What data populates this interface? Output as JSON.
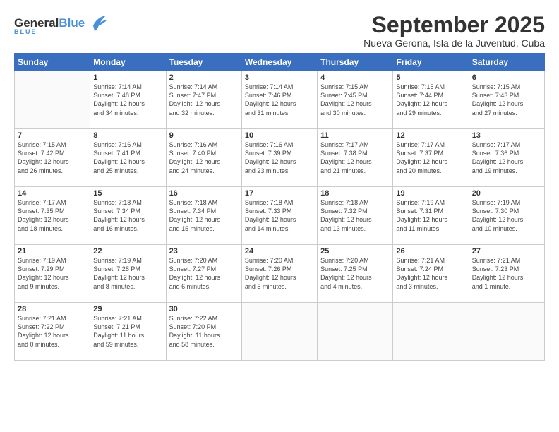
{
  "header": {
    "logo": {
      "general": "General",
      "blue": "Blue",
      "tagline": "BLUE"
    },
    "title": "September 2025",
    "subtitle": "Nueva Gerona, Isla de la Juventud, Cuba"
  },
  "weekdays": [
    "Sunday",
    "Monday",
    "Tuesday",
    "Wednesday",
    "Thursday",
    "Friday",
    "Saturday"
  ],
  "weeks": [
    [
      {
        "num": "",
        "lines": []
      },
      {
        "num": "1",
        "lines": [
          "Sunrise: 7:14 AM",
          "Sunset: 7:48 PM",
          "Daylight: 12 hours",
          "and 34 minutes."
        ]
      },
      {
        "num": "2",
        "lines": [
          "Sunrise: 7:14 AM",
          "Sunset: 7:47 PM",
          "Daylight: 12 hours",
          "and 32 minutes."
        ]
      },
      {
        "num": "3",
        "lines": [
          "Sunrise: 7:14 AM",
          "Sunset: 7:46 PM",
          "Daylight: 12 hours",
          "and 31 minutes."
        ]
      },
      {
        "num": "4",
        "lines": [
          "Sunrise: 7:15 AM",
          "Sunset: 7:45 PM",
          "Daylight: 12 hours",
          "and 30 minutes."
        ]
      },
      {
        "num": "5",
        "lines": [
          "Sunrise: 7:15 AM",
          "Sunset: 7:44 PM",
          "Daylight: 12 hours",
          "and 29 minutes."
        ]
      },
      {
        "num": "6",
        "lines": [
          "Sunrise: 7:15 AM",
          "Sunset: 7:43 PM",
          "Daylight: 12 hours",
          "and 27 minutes."
        ]
      }
    ],
    [
      {
        "num": "7",
        "lines": [
          "Sunrise: 7:15 AM",
          "Sunset: 7:42 PM",
          "Daylight: 12 hours",
          "and 26 minutes."
        ]
      },
      {
        "num": "8",
        "lines": [
          "Sunrise: 7:16 AM",
          "Sunset: 7:41 PM",
          "Daylight: 12 hours",
          "and 25 minutes."
        ]
      },
      {
        "num": "9",
        "lines": [
          "Sunrise: 7:16 AM",
          "Sunset: 7:40 PM",
          "Daylight: 12 hours",
          "and 24 minutes."
        ]
      },
      {
        "num": "10",
        "lines": [
          "Sunrise: 7:16 AM",
          "Sunset: 7:39 PM",
          "Daylight: 12 hours",
          "and 23 minutes."
        ]
      },
      {
        "num": "11",
        "lines": [
          "Sunrise: 7:17 AM",
          "Sunset: 7:38 PM",
          "Daylight: 12 hours",
          "and 21 minutes."
        ]
      },
      {
        "num": "12",
        "lines": [
          "Sunrise: 7:17 AM",
          "Sunset: 7:37 PM",
          "Daylight: 12 hours",
          "and 20 minutes."
        ]
      },
      {
        "num": "13",
        "lines": [
          "Sunrise: 7:17 AM",
          "Sunset: 7:36 PM",
          "Daylight: 12 hours",
          "and 19 minutes."
        ]
      }
    ],
    [
      {
        "num": "14",
        "lines": [
          "Sunrise: 7:17 AM",
          "Sunset: 7:35 PM",
          "Daylight: 12 hours",
          "and 18 minutes."
        ]
      },
      {
        "num": "15",
        "lines": [
          "Sunrise: 7:18 AM",
          "Sunset: 7:34 PM",
          "Daylight: 12 hours",
          "and 16 minutes."
        ]
      },
      {
        "num": "16",
        "lines": [
          "Sunrise: 7:18 AM",
          "Sunset: 7:34 PM",
          "Daylight: 12 hours",
          "and 15 minutes."
        ]
      },
      {
        "num": "17",
        "lines": [
          "Sunrise: 7:18 AM",
          "Sunset: 7:33 PM",
          "Daylight: 12 hours",
          "and 14 minutes."
        ]
      },
      {
        "num": "18",
        "lines": [
          "Sunrise: 7:18 AM",
          "Sunset: 7:32 PM",
          "Daylight: 12 hours",
          "and 13 minutes."
        ]
      },
      {
        "num": "19",
        "lines": [
          "Sunrise: 7:19 AM",
          "Sunset: 7:31 PM",
          "Daylight: 12 hours",
          "and 11 minutes."
        ]
      },
      {
        "num": "20",
        "lines": [
          "Sunrise: 7:19 AM",
          "Sunset: 7:30 PM",
          "Daylight: 12 hours",
          "and 10 minutes."
        ]
      }
    ],
    [
      {
        "num": "21",
        "lines": [
          "Sunrise: 7:19 AM",
          "Sunset: 7:29 PM",
          "Daylight: 12 hours",
          "and 9 minutes."
        ]
      },
      {
        "num": "22",
        "lines": [
          "Sunrise: 7:19 AM",
          "Sunset: 7:28 PM",
          "Daylight: 12 hours",
          "and 8 minutes."
        ]
      },
      {
        "num": "23",
        "lines": [
          "Sunrise: 7:20 AM",
          "Sunset: 7:27 PM",
          "Daylight: 12 hours",
          "and 6 minutes."
        ]
      },
      {
        "num": "24",
        "lines": [
          "Sunrise: 7:20 AM",
          "Sunset: 7:26 PM",
          "Daylight: 12 hours",
          "and 5 minutes."
        ]
      },
      {
        "num": "25",
        "lines": [
          "Sunrise: 7:20 AM",
          "Sunset: 7:25 PM",
          "Daylight: 12 hours",
          "and 4 minutes."
        ]
      },
      {
        "num": "26",
        "lines": [
          "Sunrise: 7:21 AM",
          "Sunset: 7:24 PM",
          "Daylight: 12 hours",
          "and 3 minutes."
        ]
      },
      {
        "num": "27",
        "lines": [
          "Sunrise: 7:21 AM",
          "Sunset: 7:23 PM",
          "Daylight: 12 hours",
          "and 1 minute."
        ]
      }
    ],
    [
      {
        "num": "28",
        "lines": [
          "Sunrise: 7:21 AM",
          "Sunset: 7:22 PM",
          "Daylight: 12 hours",
          "and 0 minutes."
        ]
      },
      {
        "num": "29",
        "lines": [
          "Sunrise: 7:21 AM",
          "Sunset: 7:21 PM",
          "Daylight: 11 hours",
          "and 59 minutes."
        ]
      },
      {
        "num": "30",
        "lines": [
          "Sunrise: 7:22 AM",
          "Sunset: 7:20 PM",
          "Daylight: 11 hours",
          "and 58 minutes."
        ]
      },
      {
        "num": "",
        "lines": []
      },
      {
        "num": "",
        "lines": []
      },
      {
        "num": "",
        "lines": []
      },
      {
        "num": "",
        "lines": []
      }
    ]
  ]
}
